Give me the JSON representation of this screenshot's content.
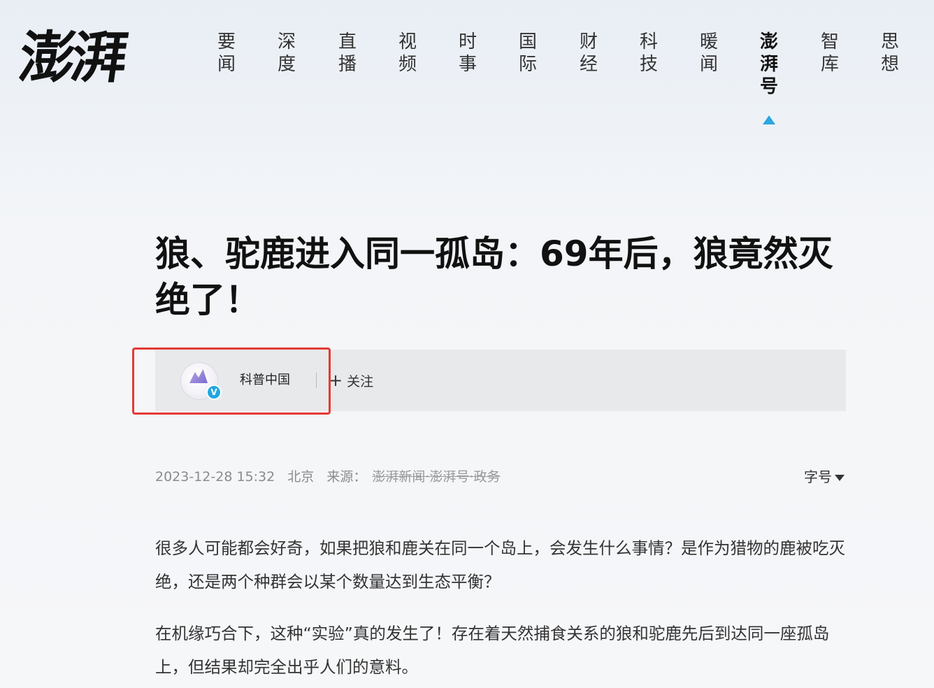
{
  "logo": {
    "text": "澎湃"
  },
  "nav": {
    "items": [
      {
        "label": "要闻"
      },
      {
        "label": "深度"
      },
      {
        "label": "直播"
      },
      {
        "label": "视频"
      },
      {
        "label": "时事"
      },
      {
        "label": "国际"
      },
      {
        "label": "财经"
      },
      {
        "label": "科技"
      },
      {
        "label": "暖闻"
      },
      {
        "label": "澎湃号"
      },
      {
        "label": "智库"
      },
      {
        "label": "思想"
      }
    ],
    "active": "澎湃号",
    "indicator_color": "#2ba7e0"
  },
  "article": {
    "title": "狼、驼鹿进入同一孤岛：69年后，狼竟然灭绝了！",
    "author": {
      "name": "科普中国",
      "verified_badge": "V",
      "follow_label": "关注",
      "follow_icon": "plus-icon"
    },
    "meta": {
      "datetime": "2023-12-28 15:32",
      "location": "北京",
      "source_label": "来源：",
      "source_name": "澎湃新闻·澎湃号·政务"
    },
    "font_size_label": "字号",
    "paragraphs": [
      "很多人可能都会好奇，如果把狼和鹿关在同一个岛上，会发生什么事情？是作为猎物的鹿被吃灭绝，还是两个种群会以某个数量达到生态平衡？",
      "在机缘巧合下，这种“实验”真的发生了！存在着天然捕食关系的狼和驼鹿先后到达同一座孤岛上，但结果却完全出乎人们的意料。"
    ]
  },
  "colors": {
    "highlight_box": "#e53935",
    "verified_badge": "#22a7e0"
  }
}
